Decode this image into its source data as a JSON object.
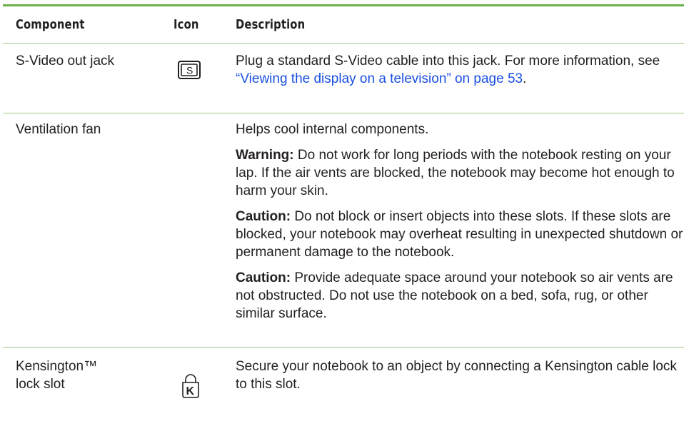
{
  "headers": {
    "component": "Component",
    "icon": "Icon",
    "description": "Description"
  },
  "rows": [
    {
      "component": "S-Video out jack",
      "icon": "s-video-icon",
      "desc_pre": "Plug a standard S-Video cable into this jack. For more information, see ",
      "desc_link": "“Viewing the display on a television” on page 53",
      "desc_post": "."
    },
    {
      "component": "Ventilation fan",
      "icon": "",
      "paragraphs": [
        {
          "lead": "",
          "text": "Helps cool internal components."
        },
        {
          "lead": "Warning:",
          "text": " Do not work for long periods with the notebook resting on your lap. If the air vents are blocked, the notebook may become hot enough to harm your skin."
        },
        {
          "lead": "Caution:",
          "text": " Do not block or insert objects into these slots. If these slots are blocked, your notebook may overheat resulting in unexpected shutdown or permanent damage to the notebook."
        },
        {
          "lead": "Caution:",
          "text": " Provide adequate space around your notebook so air vents are not obstructed. Do not use the notebook on a bed, sofa, rug, or other similar surface."
        }
      ]
    },
    {
      "component_line1": "Kensington™",
      "component_line2": "lock slot",
      "icon": "kensington-lock-icon",
      "icon_letter": "K",
      "description": "Secure your notebook to an object by connecting a Kensington cable lock to this slot."
    }
  ],
  "colors": {
    "rule": "#6ab04c",
    "link": "#1a4fe0",
    "text": "#231f20"
  }
}
